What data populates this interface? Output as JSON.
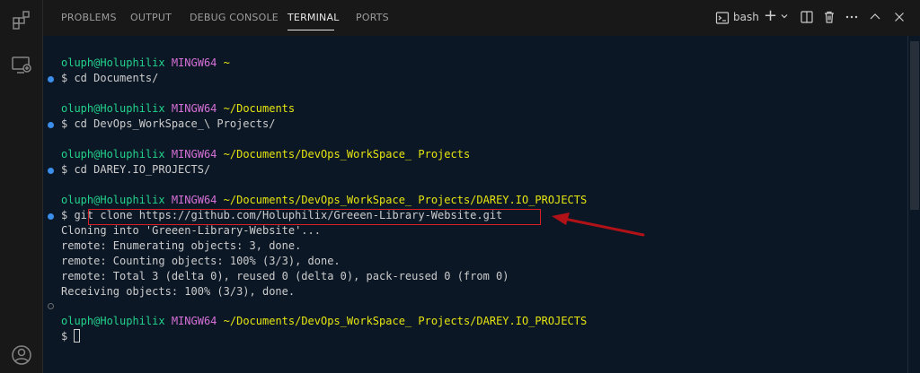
{
  "panel": {
    "tabs": [
      {
        "label": "PROBLEMS"
      },
      {
        "label": "OUTPUT"
      },
      {
        "label": "DEBUG CONSOLE"
      },
      {
        "label": "TERMINAL",
        "active": true
      },
      {
        "label": "PORTS"
      }
    ],
    "shell_label": "bash",
    "toolbar_icons": [
      "terminal-icon",
      "plus-icon",
      "chevron-down-icon",
      "split-icon",
      "trash-icon",
      "more-icon",
      "maximize-icon",
      "close-icon"
    ]
  },
  "terminal": {
    "blocks": [
      {
        "user": "oluph@Holuphilix",
        "host": "MINGW64",
        "path": "~",
        "command": "$ cd Documents/"
      },
      {
        "user": "oluph@Holuphilix",
        "host": "MINGW64",
        "path": "~/Documents",
        "command": "$ cd DevOps_WorkSpace_\\ Projects/"
      },
      {
        "user": "oluph@Holuphilix",
        "host": "MINGW64",
        "path": "~/Documents/DevOps_WorkSpace_ Projects",
        "command": "$ cd DAREY.IO_PROJECTS/"
      },
      {
        "user": "oluph@Holuphilix",
        "host": "MINGW64",
        "path": "~/Documents/DevOps_WorkSpace_ Projects/DAREY.IO_PROJECTS",
        "command": "$ git clone https://github.com/Holuphilix/Greeen-Library-Website.git"
      }
    ],
    "output": [
      "Cloning into 'Greeen-Library-Website'...",
      "remote: Enumerating objects: 3, done.",
      "remote: Counting objects: 100% (3/3), done.",
      "remote: Total 3 (delta 0), reused 0 (delta 0), pack-reused 0 (from 0)",
      "Receiving objects: 100% (3/3), done."
    ],
    "final_prompt": {
      "user": "oluph@Holuphilix",
      "host": "MINGW64",
      "path": "~/Documents/DevOps_WorkSpace_ Projects/DAREY.IO_PROJECTS",
      "command": "$ "
    }
  },
  "colors": {
    "background": "#0c1726",
    "user": "#23d18b",
    "host": "#d670d6",
    "path": "#e5e510",
    "highlight": "#d81f26",
    "annotation_arrow": "#b01217"
  }
}
